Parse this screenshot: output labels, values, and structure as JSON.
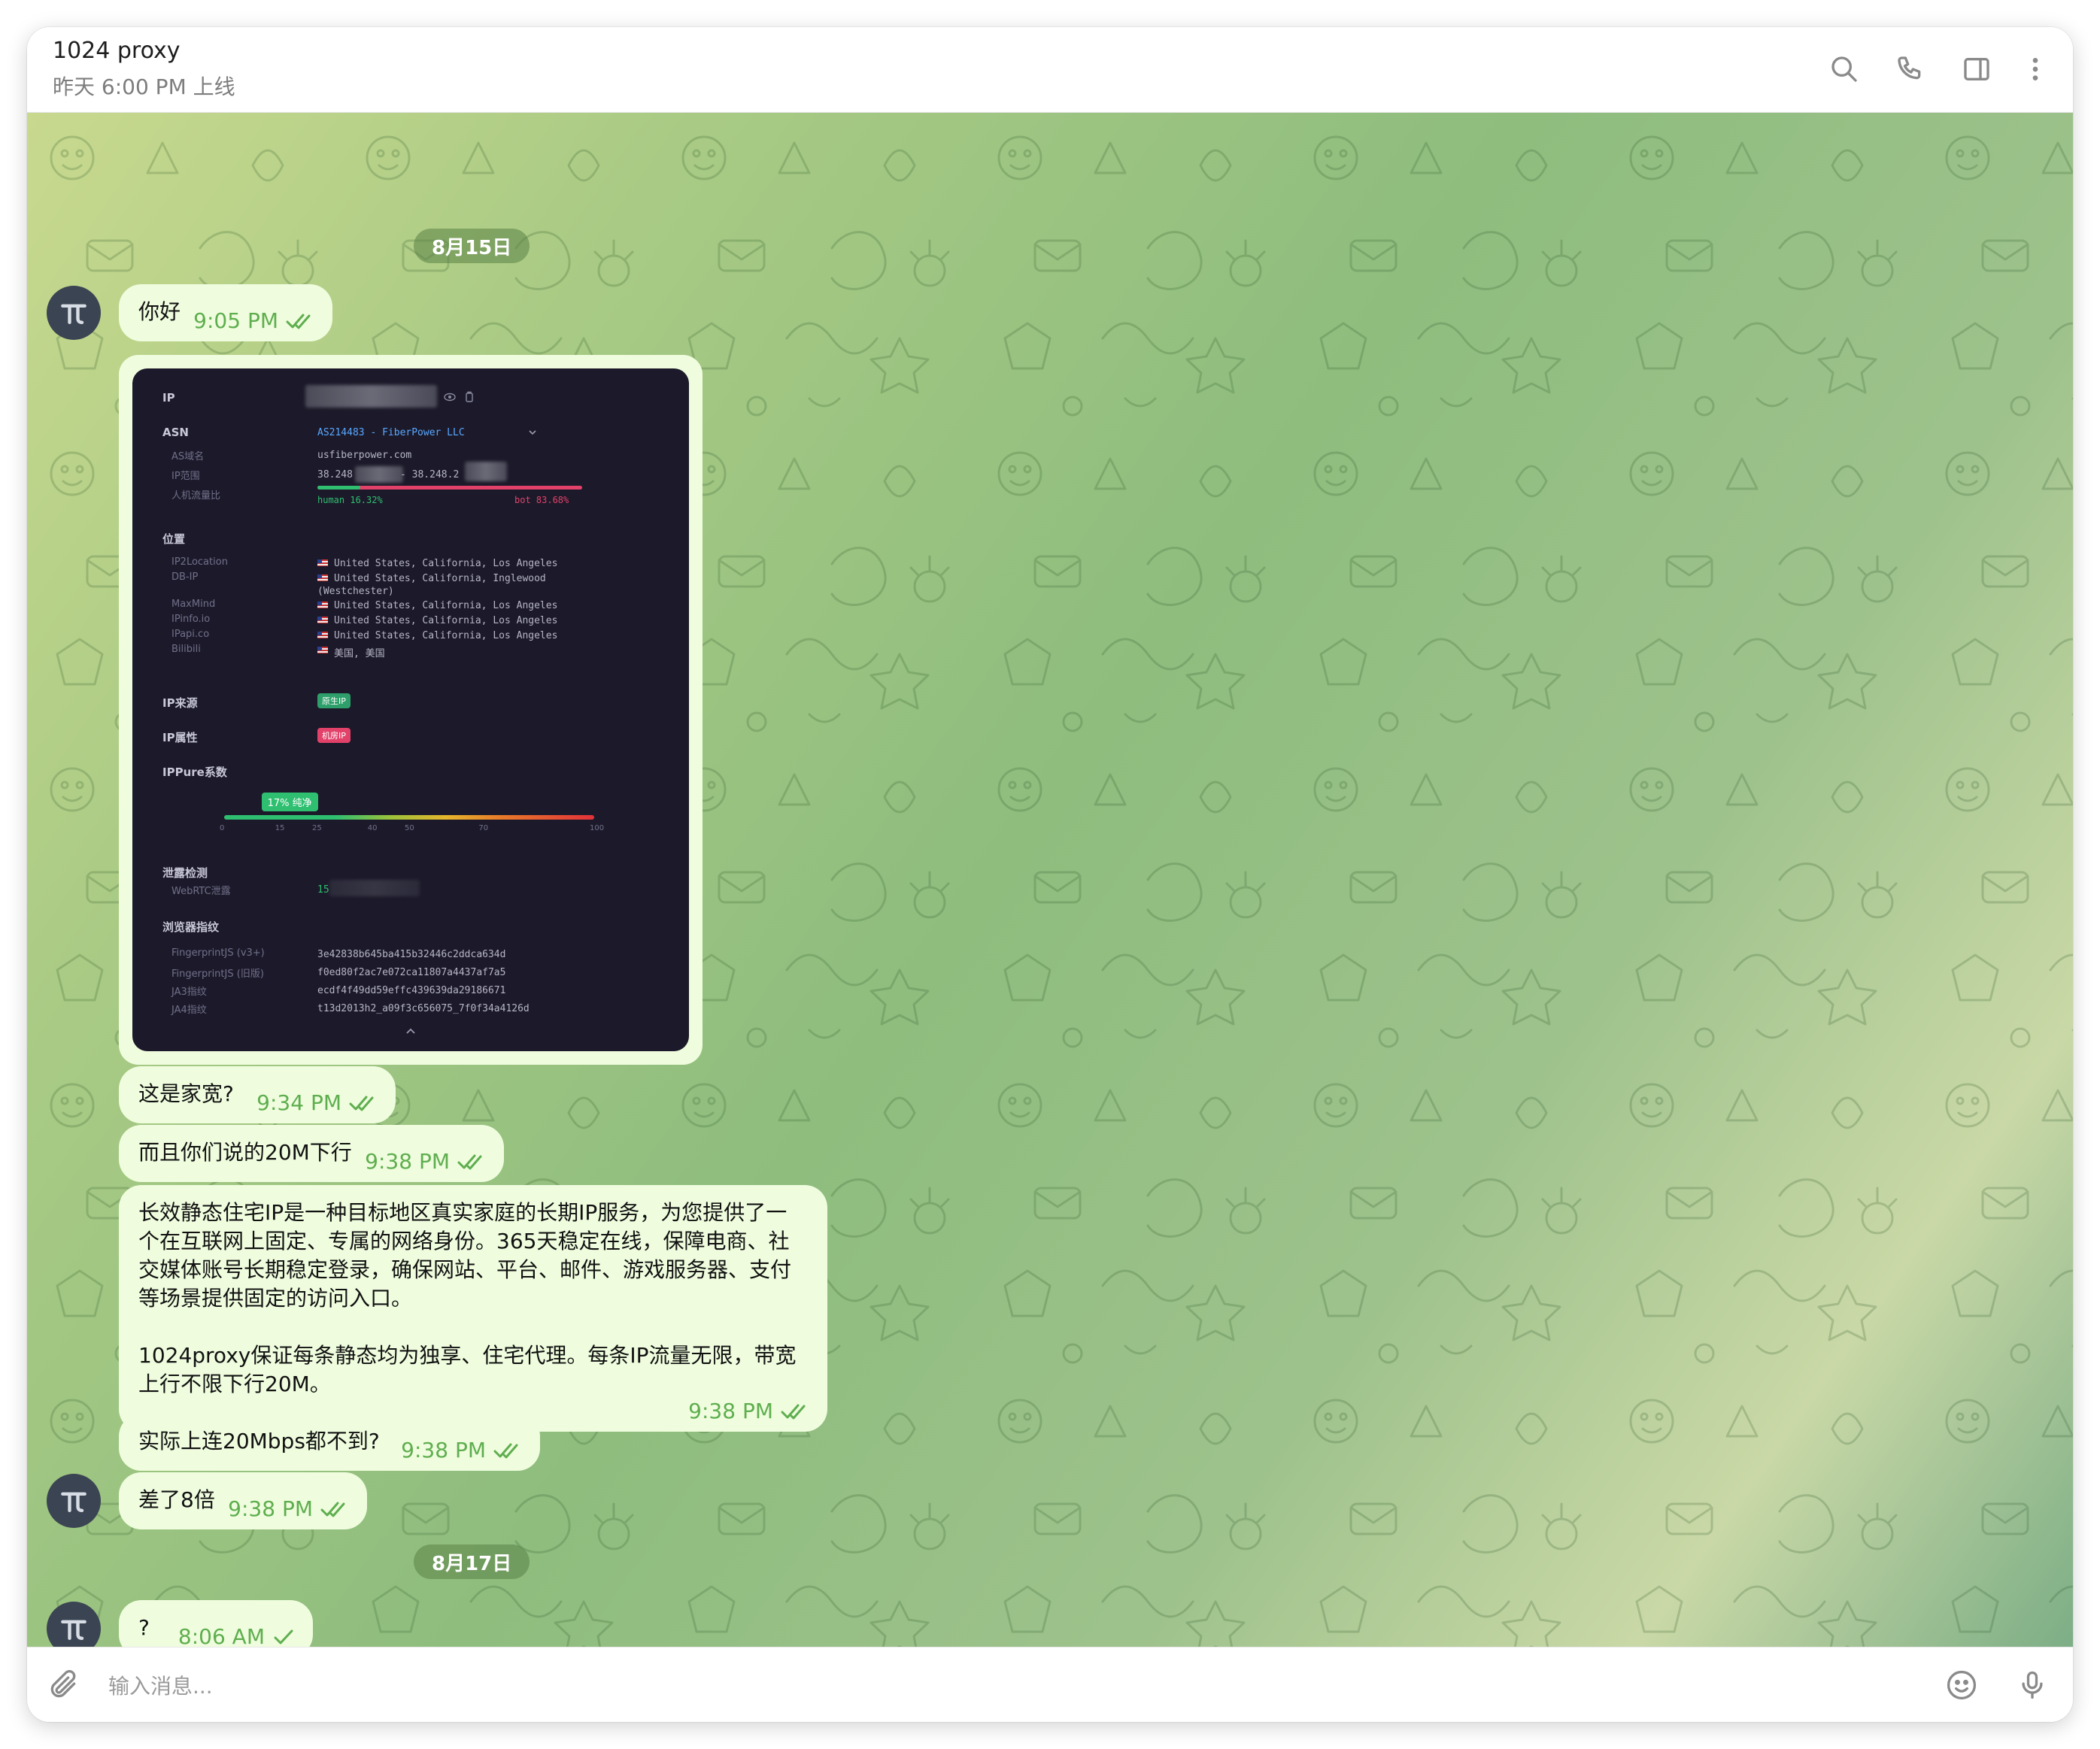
{
  "header": {
    "title": "1024 proxy",
    "status": "昨天 6:00 PM 上线",
    "icons": [
      "search-icon",
      "phone-icon",
      "sidebar-icon",
      "more-icon"
    ]
  },
  "colors": {
    "bubble_out": "#effdde",
    "check_green": "#5fae4f",
    "date_pill": "#7aa464",
    "avatar": "#3b4452"
  },
  "dates": {
    "first": "8月15日",
    "second": "8月17日"
  },
  "messages": {
    "m1": {
      "text": "你好",
      "time": "9:05 PM"
    },
    "m3": {
      "text": "这是家宽?",
      "time": "9:34 PM"
    },
    "m4": {
      "text": "而且你们说的20M下行",
      "time": "9:38 PM"
    },
    "m5": {
      "text": "长效静态住宅IP是一种目标地区真实家庭的长期IP服务，为您提供了一个在互联网上固定、专属的网络身份。365天稳定在线，保障电商、社交媒体账号长期稳定登录，确保网站、平台、邮件、游戏服务器、支付等场景提供固定的访问入口。\n\n1024proxy保证每条静态均为独享、住宅代理。每条IP流量无限，带宽上行不限下行20M。",
      "time": "9:38 PM"
    },
    "m6": {
      "text": "实际上连20Mbps都不到?",
      "time": "9:38 PM"
    },
    "m7": {
      "text": "差了8倍",
      "time": "9:38 PM"
    },
    "m8": {
      "text": "?",
      "time": "8:06 AM"
    }
  },
  "screenshot": {
    "ip_label": "IP",
    "asn_label": "ASN",
    "asn_value": "AS214483 - FiberPower LLC",
    "as_domain_label": "AS域名",
    "as_domain_value": "usfiberpower.com",
    "ip_range_label": "IP范围",
    "ip_range_start": "38.248",
    "ip_range_end": "- 38.248.2",
    "traffic_label": "人机流量比",
    "human": "human 16.32%",
    "bot": "bot 83.68%",
    "human_pct": 16.32,
    "location_label": "位置",
    "locations": [
      {
        "source": "IP2Location",
        "value": "United States, California, Los Angeles"
      },
      {
        "source": "DB-IP",
        "value": "United States, California, Inglewood"
      },
      {
        "source": "",
        "value": "(Westchester)"
      },
      {
        "source": "MaxMind",
        "value": "United States, California, Los Angeles"
      },
      {
        "source": "IPinfo.io",
        "value": "United States, California, Los Angeles"
      },
      {
        "source": "IPapi.co",
        "value": "United States, California, Los Angeles"
      },
      {
        "source": "Bilibili",
        "value": "美国, 美国"
      }
    ],
    "ip_source_label": "IP来源",
    "ip_source_tag": "原生IP",
    "ip_attr_label": "IP属性",
    "ip_attr_tag": "机房IP",
    "ippure_label": "IPPure系数",
    "ippure_badge": "17% 纯净",
    "ippure_value": 17,
    "ippure_ticks": [
      "0",
      "15",
      "25",
      "40",
      "50",
      "70",
      "100"
    ],
    "leak_label": "泄露检测",
    "webrtc_label": "WebRTC泄露",
    "webrtc_value": "15",
    "fp_label": "浏览器指纹",
    "fingerprints": [
      {
        "name": "FingerprintJS (v3+)",
        "value": "3e42838b645ba415b32446c2ddca634d"
      },
      {
        "name": "FingerprintJS (旧版)",
        "value": "f0ed80f2ac7e072ca11807a4437af7a5"
      },
      {
        "name": "JA3指纹",
        "value": "ecdf4f49dd59effc439639da29186671"
      },
      {
        "name": "JA4指纹",
        "value": "t13d2013h2_a09f3c656075_7f0f34a4126d"
      }
    ]
  },
  "composer": {
    "placeholder": "输入消息..."
  }
}
